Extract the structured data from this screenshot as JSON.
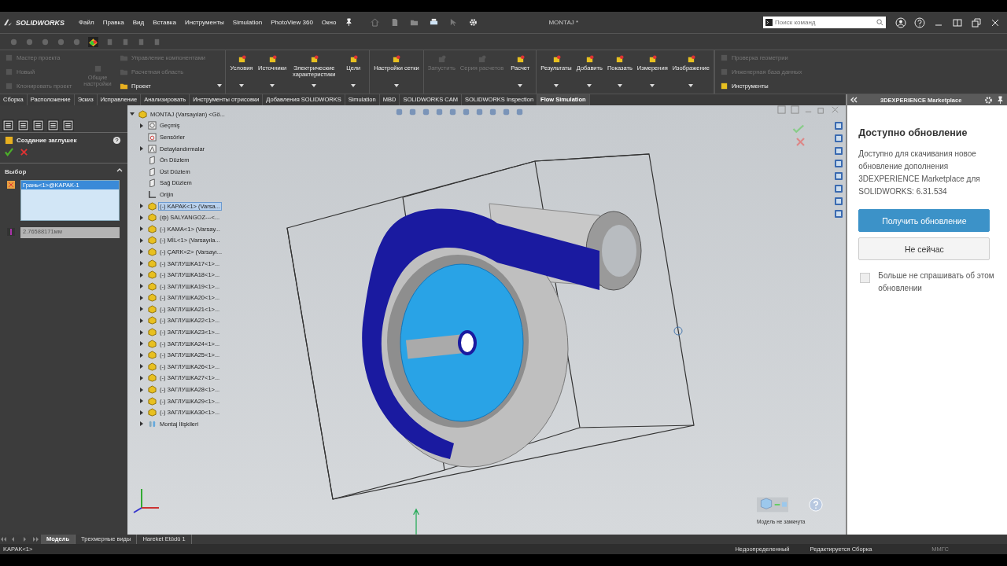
{
  "app": {
    "logo": "SOLIDWORKS"
  },
  "menu": [
    "Файл",
    "Правка",
    "Вид",
    "Вставка",
    "Инструменты",
    "Simulation",
    "PhotoView 360",
    "Окно"
  ],
  "document_title": "MONTAJ *",
  "search": {
    "placeholder": "Поиск команд"
  },
  "ribbon": {
    "left_small": [
      {
        "label": "Мастер проекта",
        "disabled": true
      },
      {
        "label": "Новый",
        "disabled": true
      },
      {
        "label": "Клонировать проект",
        "disabled": true
      }
    ],
    "general": {
      "label": "Общие настройки",
      "disabled": true
    },
    "mid_small": [
      {
        "label": "Управление компонентами",
        "disabled": true
      },
      {
        "label": "Расчетная область",
        "disabled": true
      },
      {
        "label": "Проект",
        "disabled": false
      }
    ],
    "groups": [
      [
        {
          "label": "Условия",
          "disabled": false
        },
        {
          "label": "Источники",
          "disabled": false
        },
        {
          "label": "Электрические характеристики",
          "disabled": false
        },
        {
          "label": "Цели",
          "disabled": false
        }
      ],
      [
        {
          "label": "Настройки сетки",
          "disabled": false
        }
      ],
      [
        {
          "label": "Запустить",
          "disabled": true
        },
        {
          "label": "Серия расчетов",
          "disabled": true
        },
        {
          "label": "Расчет",
          "disabled": false
        }
      ],
      [
        {
          "label": "Результаты",
          "disabled": false
        },
        {
          "label": "Добавить",
          "disabled": false
        },
        {
          "label": "Показать",
          "disabled": false
        },
        {
          "label": "Измерения",
          "disabled": false
        },
        {
          "label": "Изображение",
          "disabled": false
        }
      ]
    ],
    "right_small": [
      {
        "label": "Проверка геометрии",
        "disabled": true
      },
      {
        "label": "Инженерная база данных",
        "disabled": true
      },
      {
        "label": "Инструменты",
        "disabled": false
      }
    ]
  },
  "tabs": [
    {
      "label": "Сборка",
      "selected": false
    },
    {
      "label": "Расположение",
      "selected": false
    },
    {
      "label": "Эскиз",
      "selected": false
    },
    {
      "label": "Исправление",
      "selected": false
    },
    {
      "label": "Анализировать",
      "selected": false
    },
    {
      "label": "Инструменты отрисовки",
      "selected": false
    },
    {
      "label": "Добавления SOLIDWORKS",
      "selected": false
    },
    {
      "label": "Simulation",
      "selected": false
    },
    {
      "label": "MBD",
      "selected": false
    },
    {
      "label": "SOLIDWORKS CAM",
      "selected": false
    },
    {
      "label": "SOLIDWORKS Inspection",
      "selected": false
    },
    {
      "label": "Flow Simulation",
      "selected": true
    }
  ],
  "property_manager": {
    "title": "Создание заглушек",
    "section": "Выбор",
    "selection": "Грань<1>@KAPAK-1",
    "thickness": "2.76588171мм"
  },
  "tree": {
    "root": "MONTAJ (Varsayılan) <Gö...",
    "expanded": true,
    "children": [
      {
        "label": "Geçmiş",
        "kind": "history",
        "has_children": true,
        "selected": false
      },
      {
        "label": "Sensörler",
        "kind": "sensor",
        "has_children": false,
        "selected": false
      },
      {
        "label": "Detaylandırmalar",
        "kind": "annotation",
        "has_children": true,
        "selected": false
      },
      {
        "label": "Ön Düzlem",
        "kind": "plane",
        "has_children": false,
        "selected": false
      },
      {
        "label": "Üst Düzlem",
        "kind": "plane",
        "has_children": false,
        "selected": false
      },
      {
        "label": "Sağ Düzlem",
        "kind": "plane",
        "has_children": false,
        "selected": false
      },
      {
        "label": "Orijin",
        "kind": "origin",
        "has_children": false,
        "selected": false
      },
      {
        "label": "(-) KAPAK<1> (Varsa...",
        "kind": "part",
        "has_children": true,
        "selected": true
      },
      {
        "label": "(ф) SALYANGOZ---<...",
        "kind": "part",
        "has_children": true,
        "selected": false
      },
      {
        "label": "(-) KAMA<1> (Varsay...",
        "kind": "part",
        "has_children": true,
        "selected": false
      },
      {
        "label": "(-) MİL<1> (Varsayıla...",
        "kind": "part",
        "has_children": true,
        "selected": false
      },
      {
        "label": "(-) ÇARK<2> (Varsayı...",
        "kind": "part",
        "has_children": true,
        "selected": false
      },
      {
        "label": "(-) ЗАГЛУШКА17<1>...",
        "kind": "part",
        "has_children": true,
        "selected": false
      },
      {
        "label": "(-) ЗАГЛУШКА18<1>...",
        "kind": "part",
        "has_children": true,
        "selected": false
      },
      {
        "label": "(-) ЗАГЛУШКА19<1>...",
        "kind": "part",
        "has_children": true,
        "selected": false
      },
      {
        "label": "(-) ЗАГЛУШКА20<1>...",
        "kind": "part",
        "has_children": true,
        "selected": false
      },
      {
        "label": "(-) ЗАГЛУШКА21<1>...",
        "kind": "part",
        "has_children": true,
        "selected": false
      },
      {
        "label": "(-) ЗАГЛУШКА22<1>...",
        "kind": "part",
        "has_children": true,
        "selected": false
      },
      {
        "label": "(-) ЗАГЛУШКА23<1>...",
        "kind": "part",
        "has_children": true,
        "selected": false
      },
      {
        "label": "(-) ЗАГЛУШКА24<1>...",
        "kind": "part",
        "has_children": true,
        "selected": false
      },
      {
        "label": "(-) ЗАГЛУШКА25<1>...",
        "kind": "part",
        "has_children": true,
        "selected": false
      },
      {
        "label": "(-) ЗАГЛУШКА26<1>...",
        "kind": "part",
        "has_children": true,
        "selected": false
      },
      {
        "label": "(-) ЗАГЛУШКА27<1>...",
        "kind": "part",
        "has_children": true,
        "selected": false
      },
      {
        "label": "(-) ЗАГЛУШКА28<1>...",
        "kind": "part",
        "has_children": true,
        "selected": false
      },
      {
        "label": "(-) ЗАГЛУШКА29<1>...",
        "kind": "part",
        "has_children": true,
        "selected": false
      },
      {
        "label": "(-) ЗАГЛУШКА30<1>...",
        "kind": "part",
        "has_children": true,
        "selected": false
      },
      {
        "label": "Montaj İlişkileri",
        "kind": "mates",
        "has_children": true,
        "selected": false
      }
    ]
  },
  "viewport": {
    "status_note": "Модель не замкнута"
  },
  "marketplace": {
    "header": "3DEXPERIENCE Marketplace",
    "title": "Доступно обновление",
    "message": "Доступно для скачивания новое обновление дополнения 3DEXPERIENCE Marketplace для SOLIDWORKS: 6.31.534",
    "primary_button": "Получить обновление",
    "secondary_button": "Не сейчас",
    "dont_ask": {
      "label": "Больше не спрашивать об этом обновлении",
      "checked": false
    }
  },
  "bottom_tabs": [
    {
      "label": "Модель",
      "selected": true
    },
    {
      "label": "Трехмерные виды",
      "selected": false
    },
    {
      "label": "Hareket Etüdü 1",
      "selected": false
    }
  ],
  "status_bar": {
    "selection": "KAPAK<1>",
    "definition": "Недоопределенный",
    "mode": "Редактируется Сборка",
    "units": "ММГС"
  }
}
